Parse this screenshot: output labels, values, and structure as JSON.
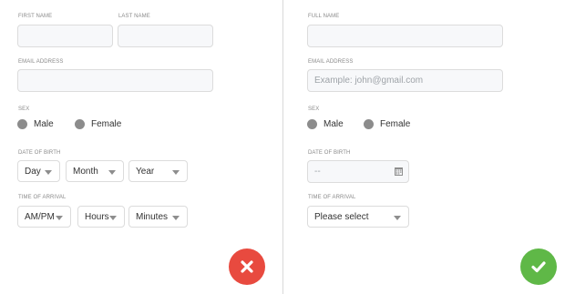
{
  "left_form": {
    "first_name_label": "FIRST NAME",
    "last_name_label": "LAST NAME",
    "email_label": "EMAIL ADDRESS",
    "sex_label": "SEX",
    "sex_options": [
      "Male",
      "Female"
    ],
    "dob_label": "DATE OF BIRTH",
    "dob_day": "Day",
    "dob_month": "Month",
    "dob_year": "Year",
    "arrival_label": "TIME OF ARRIVAL",
    "arrival_ampm": "AM/PM",
    "arrival_hours": "Hours",
    "arrival_minutes": "Minutes"
  },
  "right_form": {
    "full_name_label": "FULL NAME",
    "email_label": "EMAIL ADDRESS",
    "email_placeholder": "Example: john@gmail.com",
    "sex_label": "SEX",
    "sex_options": [
      "Male",
      "Female"
    ],
    "dob_label": "DATE OF BIRTH",
    "dob_placeholder": "--",
    "arrival_label": "TIME OF ARRIVAL",
    "arrival_select": "Please select"
  },
  "icons": {
    "cancel": "close-icon",
    "confirm": "check-icon",
    "calendar": "calendar-icon",
    "dropdown": "chevron-down-icon"
  },
  "colors": {
    "cancel_button": "#e84a3f",
    "confirm_button": "#5fb847",
    "radio_dot": "#8c8c8c",
    "field_bg": "#f7f8fa",
    "field_border": "#dcdcdc"
  }
}
